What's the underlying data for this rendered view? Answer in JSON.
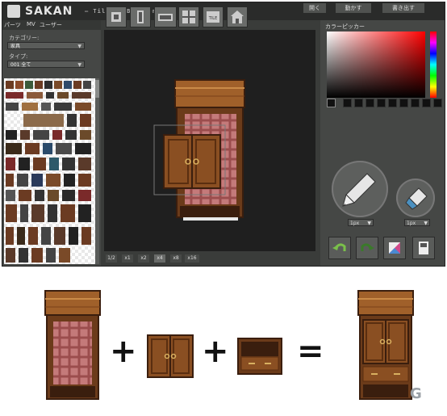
{
  "app": {
    "title": "SAKAN",
    "subtitle": "— Tileset Builder —",
    "top_buttons": [
      "開く",
      "動かす",
      "書き出す"
    ]
  },
  "left_panel": {
    "tabs": [
      "パーツ",
      "MV",
      "ユーザー"
    ],
    "category_label": "カテゴリー:",
    "category_value": "家具",
    "type_label": "タイプ:",
    "type_value": "001 全て"
  },
  "toolbar": {
    "icons": [
      "pencil-tool-icon",
      "cabinet-tool-icon",
      "copy-tool-icon",
      "grid-tool-icon",
      "tile-tool-icon",
      "home-tool-icon"
    ],
    "labels": [
      "",
      "",
      "",
      "",
      "TILE",
      ""
    ]
  },
  "zoom": {
    "levels": [
      "1/2",
      "x1",
      "x2",
      "x4",
      "x8",
      "x16"
    ],
    "active": "x4"
  },
  "right_panel": {
    "color_picker_title": "カラーピッカー",
    "pen_size": "1px",
    "eraser_size": "1px",
    "buttons": [
      "undo-icon",
      "redo-icon",
      "palette-icon",
      "save-icon"
    ]
  },
  "watermark": "G"
}
